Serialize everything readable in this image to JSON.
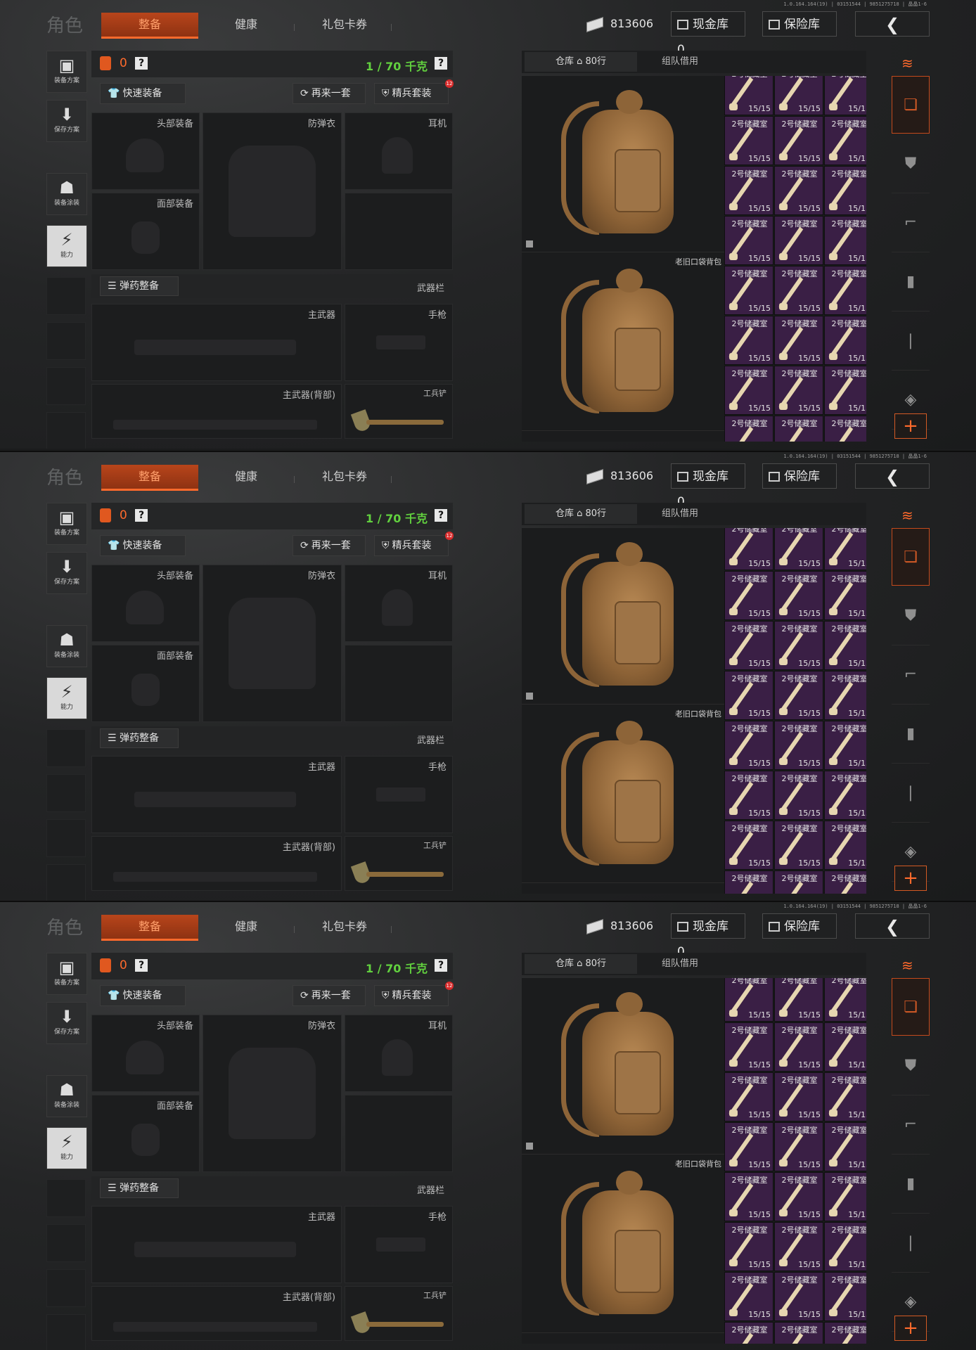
{
  "top": {
    "title": "角色",
    "tabs": [
      "整备",
      "健康",
      "礼包卡券"
    ],
    "money": "813606",
    "cash_vault": "现金库 0",
    "safe_vault": "保险库",
    "versions": [
      "1.0.164.164(19) | 03151544 | 9851275718 | 晶晶1-6",
      "1.0.164.164(19) | 03151544 | 9851275718 | 晶晶1-6",
      "1.0.164.164(19) | 03151544 | 9851275718 | 晶晶1-6"
    ]
  },
  "left_menu": {
    "equip_plan": "装备方案",
    "save_plan": "保存方案",
    "equip_paint": "装备涂装",
    "ability": "能力"
  },
  "equipment": {
    "bag_count": "0",
    "weight": "1 / 70 千克",
    "help": "?",
    "quick_equip": "快速装备",
    "again": "再来一套",
    "elite": "精兵套装",
    "elite_badge": "12",
    "slots": {
      "head": "头部装备",
      "armor": "防弹衣",
      "earphone": "耳机",
      "face": "面部装备"
    },
    "ammo_btn": "弹药整备",
    "weapon_bar": "武器栏",
    "primary": "主武器",
    "pistol": "手枪",
    "primary_back": "主武器(背部)",
    "shovel": "工兵铲"
  },
  "warehouse": {
    "tab_main": "仓库 ⌂ 80行",
    "tab_team": "组队借用",
    "backpack_name": "老旧口袋背包",
    "cell_name": "2号储藏室",
    "cell_count": "15/15"
  },
  "colors": {
    "accent": "#ff6a2c",
    "weight_ok": "#62d13f",
    "key_cell": "#3a1f45"
  }
}
